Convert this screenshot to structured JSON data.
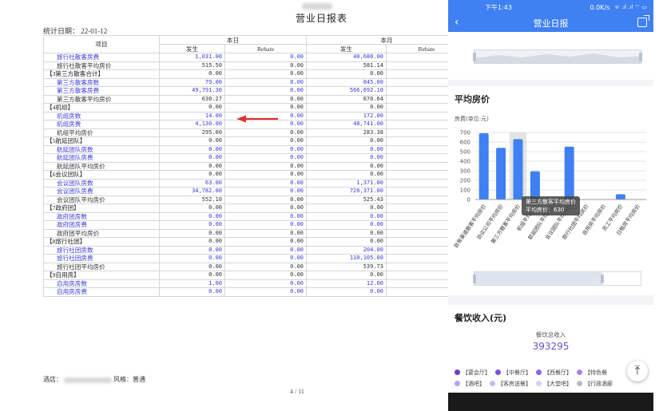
{
  "report": {
    "title": "营业日报表",
    "stat_date": "统计日期：   22-01-12",
    "header": {
      "item": "项目",
      "today": "本日",
      "month": "本月",
      "occurred": "发生",
      "rebate": "Rebate"
    },
    "rows": [
      {
        "label": "旅行社散客房费",
        "d": "1,031.00",
        "dr": "0.00",
        "m": "40,680.00",
        "style": "link"
      },
      {
        "label": "旅行社散客平均房价",
        "d": "515.50",
        "dr": "0.00",
        "m": "581.14",
        "style": "plain"
      },
      {
        "label": "【3第三方散客合计】",
        "d": "0.00",
        "dr": "0.00",
        "m": "0.00",
        "style": "group"
      },
      {
        "label": "第三方散客房数",
        "d": "79.00",
        "dr": "0.00",
        "m": "845.00",
        "style": "link"
      },
      {
        "label": "第三方散客房费",
        "d": "49,791.30",
        "dr": "0.00",
        "m": "566,692.10",
        "style": "link"
      },
      {
        "label": "第三方散客平均房价",
        "d": "630.27",
        "dr": "0.00",
        "m": "670.64",
        "style": "plain"
      },
      {
        "label": "【4机组】",
        "d": "0.00",
        "dr": "0.00",
        "m": "0.00",
        "style": "group"
      },
      {
        "label": "机组房数",
        "d": "14.00",
        "dr": "0.00",
        "m": "172.00",
        "style": "link"
      },
      {
        "label": "机组房费",
        "d": "4,130.00",
        "dr": "0.00",
        "m": "48,741.00",
        "style": "link"
      },
      {
        "label": "机组平均房价",
        "d": "295.00",
        "dr": "0.00",
        "m": "283.38",
        "style": "plain"
      },
      {
        "label": "【5航延团队】",
        "d": "0.00",
        "dr": "0.00",
        "m": "0.00",
        "style": "group"
      },
      {
        "label": "航延团队房数",
        "d": "0.00",
        "dr": "0.00",
        "m": "0.00",
        "style": "link"
      },
      {
        "label": "航延团队房费",
        "d": "0.00",
        "dr": "0.00",
        "m": "0.00",
        "style": "link"
      },
      {
        "label": "航延团队平均房价",
        "d": "0.00",
        "dr": "0.00",
        "m": "0.00",
        "style": "plain"
      },
      {
        "label": "【6会议团队】",
        "d": "0.00",
        "dr": "0.00",
        "m": "0.00",
        "style": "group"
      },
      {
        "label": "会议团队房数",
        "d": "63.00",
        "dr": "0.00",
        "m": "1,371.00",
        "style": "link"
      },
      {
        "label": "会议团队房费",
        "d": "34,782.00",
        "dr": "0.00",
        "m": "720,371.00",
        "style": "link"
      },
      {
        "label": "会议团队平均房价",
        "d": "552.10",
        "dr": "0.00",
        "m": "525.43",
        "style": "plain"
      },
      {
        "label": "【7政府团】",
        "d": "0.00",
        "dr": "0.00",
        "m": "0.00",
        "style": "group"
      },
      {
        "label": "政府团房数",
        "d": "0.00",
        "dr": "0.00",
        "m": "0.00",
        "style": "link"
      },
      {
        "label": "政府团房费",
        "d": "0.00",
        "dr": "0.00",
        "m": "0.00",
        "style": "link"
      },
      {
        "label": "政府团平均房价",
        "d": "0.00",
        "dr": "0.00",
        "m": "0.00",
        "style": "plain"
      },
      {
        "label": "【8旅行社团】",
        "d": "0.00",
        "dr": "0.00",
        "m": "0.00",
        "style": "group"
      },
      {
        "label": "旅行社团房数",
        "d": "0.00",
        "dr": "0.00",
        "m": "204.00",
        "style": "link"
      },
      {
        "label": "旅行社团房费",
        "d": "0.00",
        "dr": "0.00",
        "m": "110,105.00",
        "style": "link"
      },
      {
        "label": "旅行社团平均房价",
        "d": "0.00",
        "dr": "0.00",
        "m": "539.73",
        "style": "plain"
      },
      {
        "label": "【9自用房】",
        "d": "0.00",
        "dr": "0.00",
        "m": "0.00",
        "style": "group"
      },
      {
        "label": "自用房房数",
        "d": "1.00",
        "dr": "0.00",
        "m": "12.00",
        "style": "link"
      },
      {
        "label": "自用房房费",
        "d": "0.00",
        "dr": "0.00",
        "m": "0.00",
        "style": "link"
      }
    ],
    "hotel_prefix": "酒店：",
    "hotel_suffix": "风格：普通",
    "pager": "4 / 11"
  },
  "phone": {
    "status": {
      "time": "下午1:43",
      "net": "0.0K/s",
      "signal": "ᯤ .ıl .ıl ⌔ ▭"
    },
    "nav": {
      "back_icon": "chevron-left",
      "title": "营业日报",
      "share_icon": "share-icon"
    },
    "chart_card": {
      "title": "平均房价",
      "unit": "房费(单位:元)",
      "tooltip_title": "第三方散客平均房价",
      "tooltip_value": "平均房价：630"
    },
    "dining": {
      "title": "餐饮收入(元)",
      "subtitle": "餐饮总收入",
      "total": "393295",
      "legend": [
        {
          "label": "【宴会厅】",
          "color": "#6a3fd1"
        },
        {
          "label": "【中餐厅】",
          "color": "#7a52dd"
        },
        {
          "label": "【西餐厅】",
          "color": "#8a67e6"
        },
        {
          "label": "【特色餐",
          "color": "#a487ee"
        },
        {
          "label": "【酒吧】",
          "color": "#b7a1f1"
        },
        {
          "label": "【客房送餐】",
          "color": "#c9b9f4"
        },
        {
          "label": "【大堂吧】",
          "color": "#d9cff7"
        },
        {
          "label": "【行政酒廊",
          "color": "#bdbdbd"
        }
      ]
    }
  },
  "chart_data": {
    "type": "bar",
    "title": "平均房价",
    "ylabel": "房费(单位:元)",
    "ylim": [
      0,
      700
    ],
    "yticks": [
      0,
      100,
      200,
      300,
      400,
      500,
      600,
      700
    ],
    "categories": [
      "自有渠道散客平均房价",
      "协议公司平均房价",
      "第三方散客平均房价",
      "机组平均房价",
      "航延团队平均房价",
      "会议团队平均房价",
      "旅行社团平均房价",
      "自用房平均房价",
      "员工平均房价",
      "日租房平均房价"
    ],
    "values": [
      693,
      540,
      630,
      295,
      0,
      552,
      0,
      0,
      55,
      0
    ],
    "highlight_index": 2,
    "bar_color": "#3f80f2"
  }
}
